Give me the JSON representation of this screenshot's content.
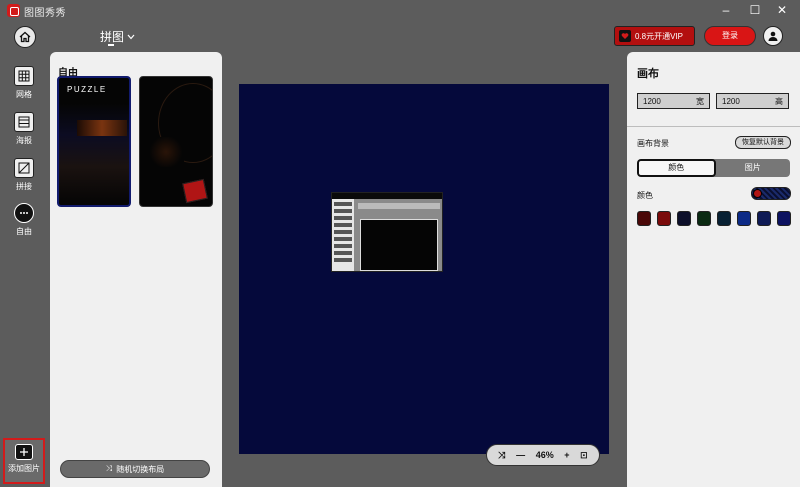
{
  "app": {
    "title": "图图秀秀"
  },
  "header": {
    "tab_label": "拼图",
    "vip_label": "0.8元开通VIP",
    "login_label": "登录"
  },
  "rail": {
    "items": [
      {
        "label": "网格",
        "icon": "grid-icon"
      },
      {
        "label": "海报",
        "icon": "poster-icon"
      },
      {
        "label": "拼接",
        "icon": "stitch-icon"
      },
      {
        "label": "自由",
        "icon": "free-icon"
      }
    ],
    "add_label": "添加图片"
  },
  "templates": {
    "section_title": "自由",
    "thumb1_text": "PUZZLE",
    "random_label": "随机切换布局"
  },
  "zoom": {
    "value": "46%"
  },
  "panel": {
    "title": "画布",
    "width_value": "1200",
    "width_unit": "宽",
    "height_value": "1200",
    "height_unit": "高",
    "bg_label": "画布背景",
    "reset_label": "恢复默认背景",
    "seg_color": "颜色",
    "seg_image": "图片",
    "color_label": "颜色",
    "swatches": [
      "#4a0808",
      "#7a0a0a",
      "#0c0f2a",
      "#0a2a12",
      "#082033",
      "#0c2a86",
      "#0e1a55",
      "#0c1260"
    ]
  },
  "colors": {
    "accent": "#d21b1b",
    "canvas_bg": "#05093b"
  }
}
